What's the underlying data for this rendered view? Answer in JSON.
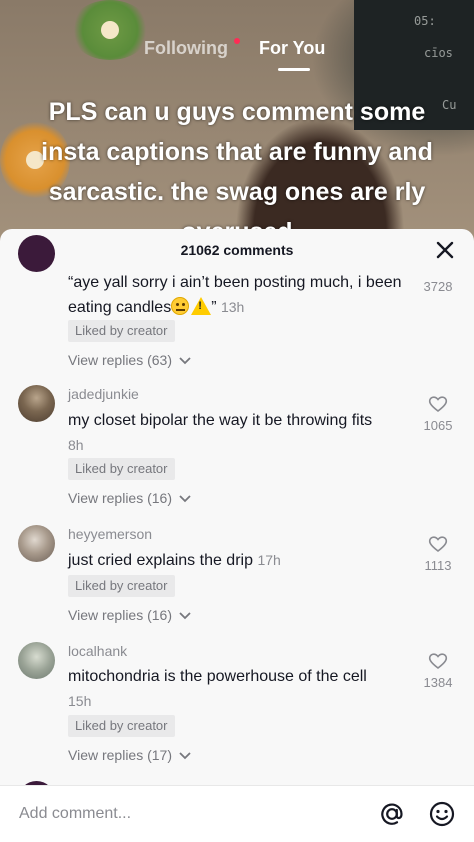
{
  "video": {
    "tabs": {
      "following": "Following",
      "for_you": "For You"
    },
    "overlay_caption": "PLS can u guys comment some insta captions that are funny and sarcastic. the swag ones are rly overused",
    "blackboard_scribbles": [
      "05:",
      "cīos",
      "Cu"
    ]
  },
  "comments_panel": {
    "title": "21062 comments",
    "close_icon": "close-icon",
    "comments": [
      {
        "username": "",
        "text": "“aye yall sorry i ain’t been posting much, i been eating candles",
        "text_suffix": "”",
        "time": "13h",
        "badge": "Liked by creator",
        "replies": "View replies (63)",
        "likes": "3728",
        "emojis": [
          "grimacing-face-emoji",
          "warning-emoji"
        ]
      },
      {
        "username": "jadedjunkie",
        "text": "my closet bipolar the way it be throwing fits",
        "time": "8h",
        "badge": "Liked by creator",
        "replies": "View replies (16)",
        "likes": "1065"
      },
      {
        "username": "heyyemerson",
        "text": "just cried explains the drip",
        "time": "17h",
        "badge": "Liked by creator",
        "replies": "View replies (16)",
        "likes": "1113"
      },
      {
        "username": "localhank",
        "text": "mitochondria is the powerhouse of the cell",
        "time": "15h",
        "badge": "Liked by creator",
        "replies": "View replies (17)",
        "likes": "1384"
      }
    ]
  },
  "input_bar": {
    "placeholder": "Add comment...",
    "mention_icon": "at-sign-icon",
    "emoji_icon": "smiley-icon"
  },
  "colors": {
    "sheet_bg": "#f8f8f8",
    "text_primary": "#161823",
    "text_secondary": "#8a8b91",
    "badge_bg": "#e9e9ea",
    "live_dot": "#fe2c55"
  }
}
